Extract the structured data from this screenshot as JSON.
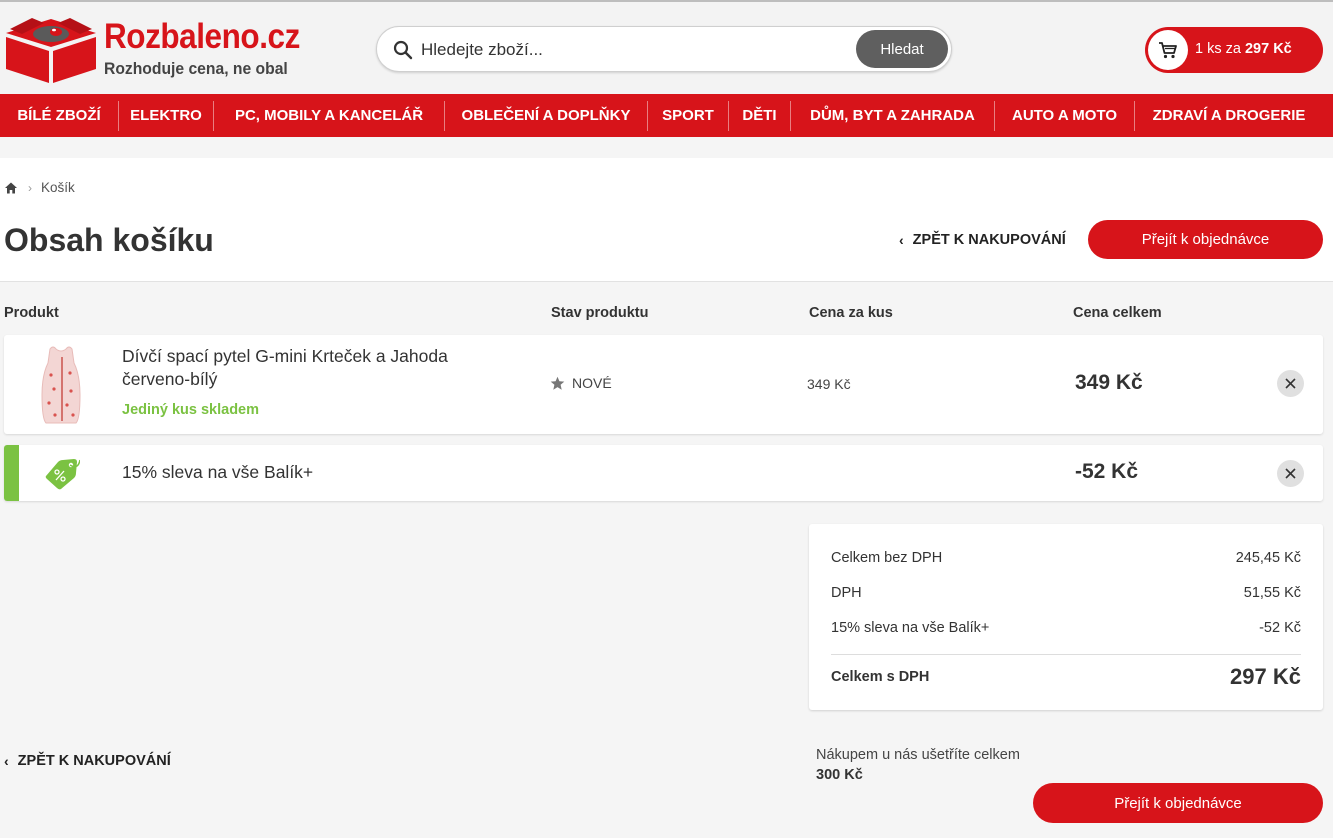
{
  "brand": {
    "name": "Rozbaleno.cz",
    "tagline": "Rozhoduje cena, ne obal",
    "color": "#d7141a"
  },
  "search": {
    "placeholder": "Hledejte zboží...",
    "button": "Hledat"
  },
  "cart": {
    "count": "1 ks za",
    "total": "297 Kč",
    "icon": "cart-icon"
  },
  "nav": {
    "items": [
      "BÍLÉ ZBOŽÍ",
      "ELEKTRO",
      "PC, MOBILY A KANCELÁŘ",
      "OBLEČENÍ A DOPLŇKY",
      "SPORT",
      "DĚTI",
      "DŮM, BYT A ZAHRADA",
      "AUTO A MOTO",
      "ZDRAVÍ A DROGERIE"
    ]
  },
  "breadcrumb": {
    "current": "Košík"
  },
  "page": {
    "title": "Obsah košíku",
    "back_label": "ZPĚT K NAKUPOVÁNÍ",
    "order_label": "Přejít k objednávce"
  },
  "table": {
    "headers": {
      "product": "Produkt",
      "condition": "Stav produktu",
      "unit_price": "Cena za kus",
      "total_price": "Cena celkem"
    },
    "items": [
      {
        "name": "Dívčí spací pytel G-mini Krteček a Jahoda červeno-bílý",
        "stock": "Jediný kus skladem",
        "condition": "NOVÉ",
        "unit_price": "349 Kč",
        "total_price": "349 Kč"
      }
    ],
    "discount": {
      "name": "15% sleva na vše Balík+",
      "price": "-52 Kč",
      "color": "#7bc242"
    }
  },
  "summary": {
    "rows": [
      {
        "label": "Celkem bez DPH",
        "value": "245,45 Kč"
      },
      {
        "label": "DPH",
        "value": "51,55 Kč"
      },
      {
        "label": "15% sleva na vše Balík+",
        "value": "-52 Kč"
      }
    ],
    "total_label": "Celkem s DPH",
    "total_value": "297 Kč"
  },
  "savings": {
    "text": "Nákupem u nás ušetříte celkem",
    "amount": "300 Kč"
  }
}
